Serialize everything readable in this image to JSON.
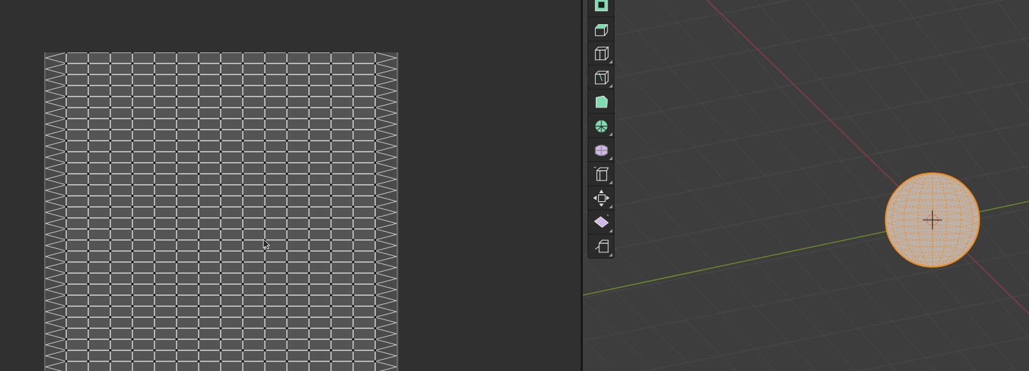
{
  "toolbar": {
    "tools": [
      {
        "selected": false,
        "submenu": false
      },
      {
        "selected": false,
        "submenu": false
      },
      {
        "selected": false,
        "submenu": true
      },
      {
        "selected": false,
        "submenu": true
      },
      {
        "selected": false,
        "submenu": false
      },
      {
        "selected": false,
        "submenu": true
      },
      {
        "selected": false,
        "submenu": true
      },
      {
        "selected": false,
        "submenu": true
      },
      {
        "selected": false,
        "submenu": true
      },
      {
        "selected": false,
        "submenu": true
      },
      {
        "selected": false,
        "submenu": true
      }
    ]
  },
  "viewport": {
    "sphere": {
      "selected": true
    }
  }
}
